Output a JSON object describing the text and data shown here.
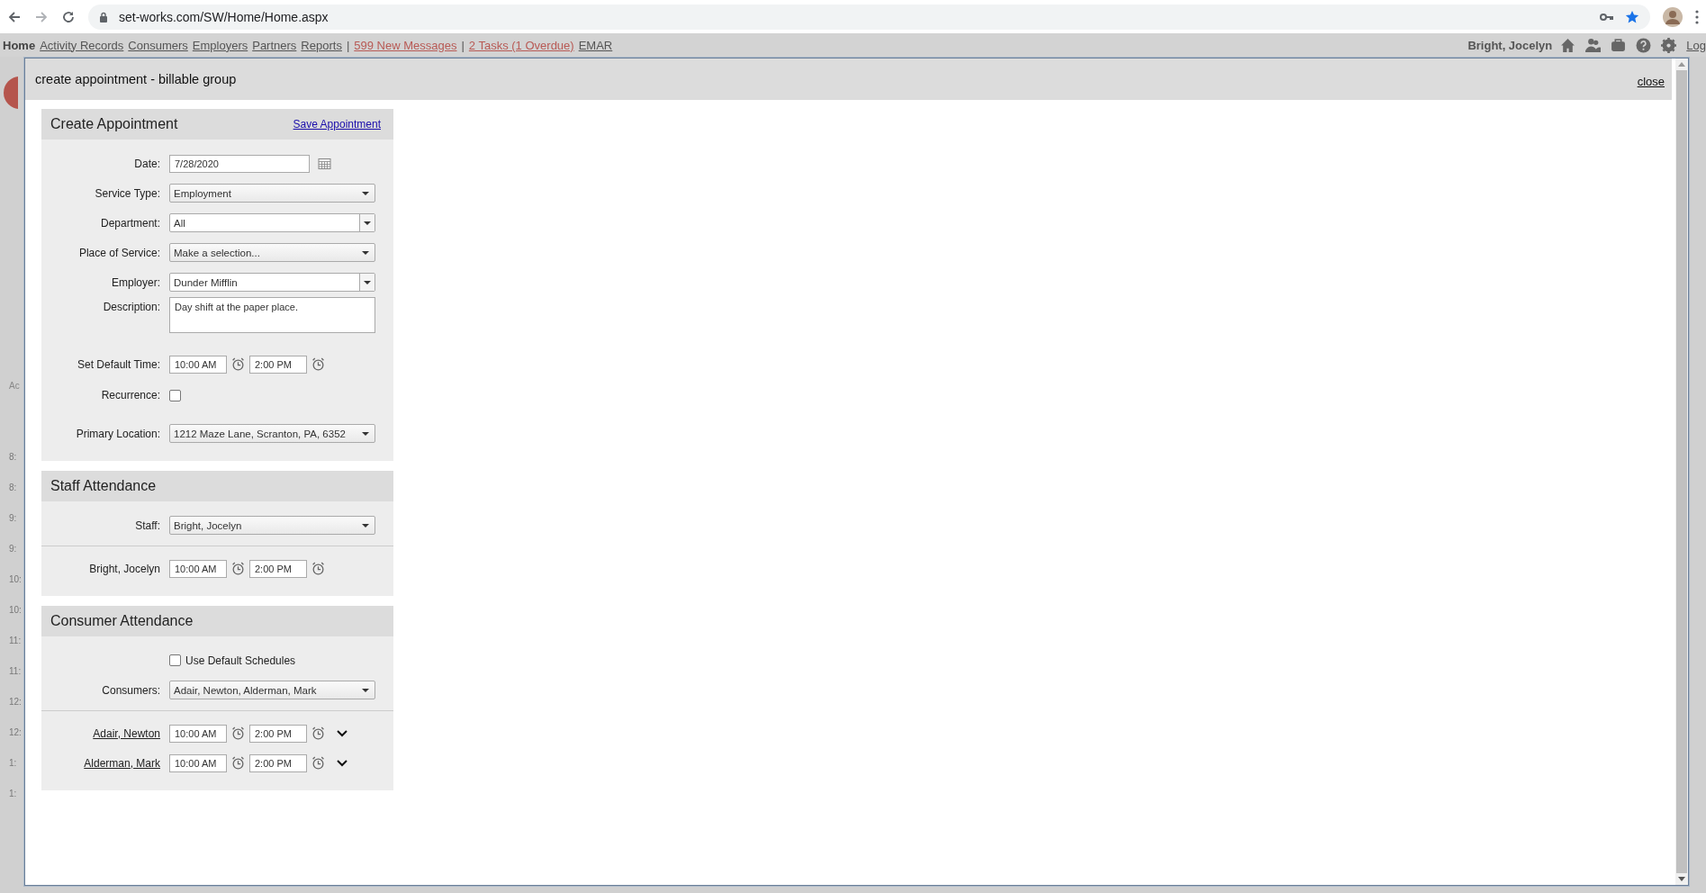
{
  "browser": {
    "url": "set-works.com/SW/Home/Home.aspx"
  },
  "nav": {
    "items": [
      {
        "label": "Home",
        "kind": "current"
      },
      {
        "label": "Activity Records",
        "kind": "link"
      },
      {
        "label": "Consumers",
        "kind": "link"
      },
      {
        "label": "Employers",
        "kind": "link"
      },
      {
        "label": "Partners",
        "kind": "link"
      },
      {
        "label": "Reports",
        "kind": "link"
      },
      {
        "label": "|",
        "kind": "separator"
      },
      {
        "label": "599 New Messages",
        "kind": "alert"
      },
      {
        "label": "|",
        "kind": "separator"
      },
      {
        "label": "2 Tasks (1 Overdue)",
        "kind": "alert"
      },
      {
        "label": "EMAR",
        "kind": "link"
      }
    ],
    "user": "Bright, Jocelyn",
    "logout": "Log"
  },
  "background": {
    "labels": [
      "Ac"
    ],
    "times": [
      "8:",
      "8:",
      "9:",
      "9:",
      "10:",
      "10:",
      "11:",
      "11:",
      "12:",
      "12:",
      "1:",
      "1:"
    ]
  },
  "dialog": {
    "title": "create appointment - billable group",
    "close": "close",
    "sections": [
      {
        "title": "Create Appointment",
        "action": "Save Appointment",
        "rows": [
          {
            "kind": "date",
            "label": "Date:",
            "value": "7/28/2020"
          },
          {
            "kind": "select",
            "label": "Service Type:",
            "value": "Employment"
          },
          {
            "kind": "combo",
            "label": "Department:",
            "value": "All"
          },
          {
            "kind": "select",
            "label": "Place of Service:",
            "value": "Make a selection..."
          },
          {
            "kind": "combo",
            "label": "Employer:",
            "value": "Dunder Mifflin"
          },
          {
            "kind": "textarea",
            "label": "Description:",
            "value": "Day shift at the paper place."
          },
          {
            "kind": "times",
            "label": "Set Default Time:",
            "start": "10:00 AM",
            "end": "2:00 PM"
          },
          {
            "kind": "checkbox",
            "label": "Recurrence:",
            "checked": false
          },
          {
            "kind": "select",
            "label": "Primary Location:",
            "value": "1212 Maze Lane, Scranton, PA, 6352"
          }
        ]
      },
      {
        "title": "Staff Attendance",
        "rows": [
          {
            "kind": "select",
            "label": "Staff:",
            "value": "Bright, Jocelyn"
          },
          {
            "kind": "divider"
          },
          {
            "kind": "times",
            "label": "Bright, Jocelyn",
            "start": "10:00 AM",
            "end": "2:00 PM"
          }
        ]
      },
      {
        "title": "Consumer Attendance",
        "rows": [
          {
            "kind": "inline_check",
            "label": "Use Default Schedules",
            "checked": false
          },
          {
            "kind": "select",
            "label": "Consumers:",
            "value": "Adair, Newton, Alderman, Mark"
          },
          {
            "kind": "divider"
          },
          {
            "kind": "person",
            "label": "Adair, Newton",
            "start": "10:00 AM",
            "end": "2:00 PM"
          },
          {
            "kind": "person",
            "label": "Alderman, Mark",
            "start": "10:00 AM",
            "end": "2:00 PM"
          }
        ]
      }
    ]
  }
}
